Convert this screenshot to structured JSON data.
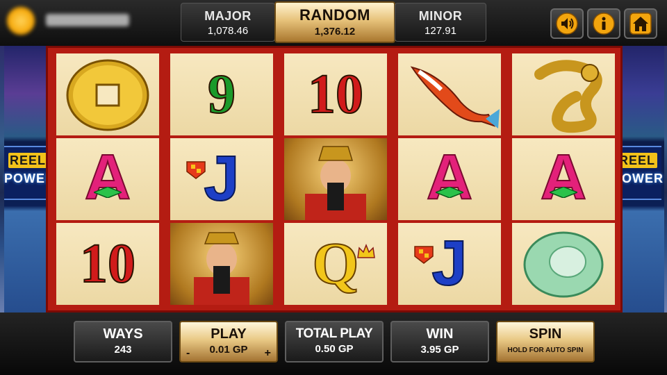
{
  "jackpots": {
    "major": {
      "label": "MAJOR",
      "value": "1,078.46"
    },
    "random": {
      "label": "RANDOM",
      "value": "1,376.12"
    },
    "minor": {
      "label": "MINOR",
      "value": "127.91"
    }
  },
  "top_buttons": [
    "speaker-icon",
    "info-icon",
    "home-icon"
  ],
  "side_banner": {
    "line1": "REEL",
    "line2": "POWER"
  },
  "reels": [
    [
      "gold-coin",
      "A",
      "10"
    ],
    [
      "9",
      "J",
      "fortune-god"
    ],
    [
      "10",
      "fortune-god",
      "Q"
    ],
    [
      "koi-fish",
      "A",
      "J"
    ],
    [
      "golden-dragon",
      "A",
      "jade-bangle"
    ]
  ],
  "symbols": {
    "r0c2": "10",
    "r1c0": "9",
    "r1c1": "J",
    "r2c0": "10",
    "r2c2": "Q",
    "r0c1": "A",
    "r3c1": "A",
    "r3c2": "J",
    "r4c1": "A"
  },
  "bottom": {
    "ways": {
      "label": "WAYS",
      "value": "243"
    },
    "play": {
      "label": "PLAY",
      "value": "0.01 GP",
      "minus": "-",
      "plus": "+"
    },
    "total_play": {
      "label": "TOTAL PLAY",
      "value": "0.50 GP"
    },
    "win": {
      "label": "WIN",
      "value": "3.95 GP"
    },
    "spin": {
      "label": "SPIN",
      "hint": "HOLD FOR AUTO SPIN"
    }
  },
  "colors": {
    "accent_gold": "#e9c985",
    "frame_red": "#b41c12",
    "panel_dark": "#1a1a1a"
  }
}
